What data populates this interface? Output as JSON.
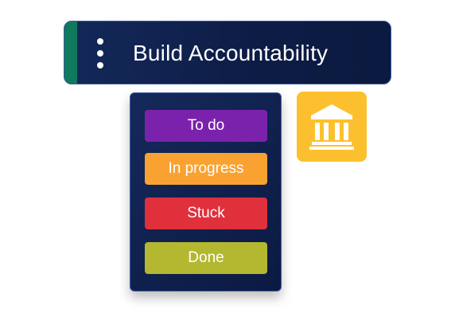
{
  "header": {
    "title": "Build Accountability",
    "accent_color": "#0f7a5c",
    "menu_icon": "kebab-menu-icon"
  },
  "status_menu": {
    "options": [
      {
        "label": "To do",
        "color": "#7b22ad"
      },
      {
        "label": "In progress",
        "color": "#f9a232"
      },
      {
        "label": "Stuck",
        "color": "#e0303c"
      },
      {
        "label": "Done",
        "color": "#b3b830"
      }
    ]
  },
  "icon_tile": {
    "icon": "bank-icon",
    "color": "#fcc02e"
  }
}
